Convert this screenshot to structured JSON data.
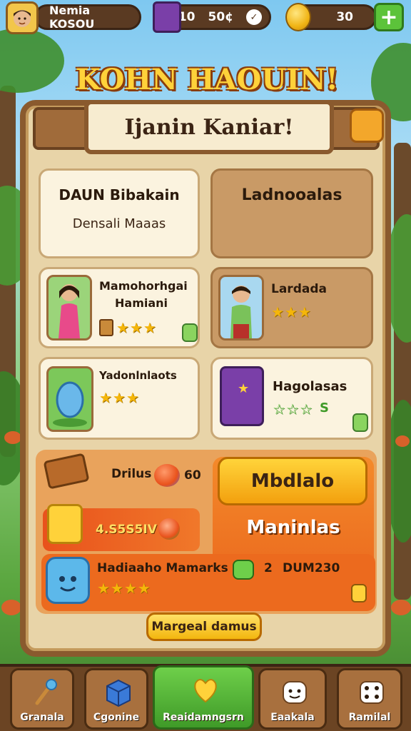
{
  "topbar": {
    "player_name": "Nemia KOSOU",
    "chest_value_a": "10",
    "chest_value_b": "50¢",
    "chest_check": "✓",
    "coins": "30",
    "plus": "+"
  },
  "title": "KOHN HAOUIN!",
  "banner": "Ijanin Kaniar!",
  "cards": {
    "top_left": {
      "title": "DAUN Bibakain",
      "subtitle": "Densali Maaas"
    },
    "top_right": {
      "title": "Ladnooalas"
    },
    "row2_left": {
      "title": "Mamohorhgai",
      "subtitle": "Hamiani",
      "stars": "★★★"
    },
    "row2_right": {
      "title": "Lardada",
      "stars": "★★★"
    },
    "row3_left": {
      "title": "Yadonlnlaots",
      "stars": "★★★"
    },
    "row3_right": {
      "title": "Hagolasas",
      "stars": "☆☆☆",
      "count": "S"
    }
  },
  "rewards": {
    "bonus_label": "Drilus",
    "bonus_value": "60",
    "offer_amount": "4.S5S5IV",
    "mystery_label": "Hadiaaho Mamarks",
    "mystery_stars": "★★★★",
    "mystery_prefix": "2",
    "mystery_value": "DUM230",
    "button_top": "Mbdlalo",
    "button_secondary": "Maninlas",
    "footer_button": "Margeal damus"
  },
  "nav": {
    "items": [
      {
        "label": "Granala"
      },
      {
        "label": "Cgonine"
      },
      {
        "label": "Reaidamngsrn"
      },
      {
        "label": "Eaakala"
      },
      {
        "label": "Ramilal"
      }
    ],
    "active_index": 2
  },
  "colors": {
    "wood": "#8a5a2e",
    "parchment": "#e8d4a8",
    "accent_orange": "#e9621c",
    "accent_green": "#5cc33a",
    "gold": "#ffd23a"
  }
}
